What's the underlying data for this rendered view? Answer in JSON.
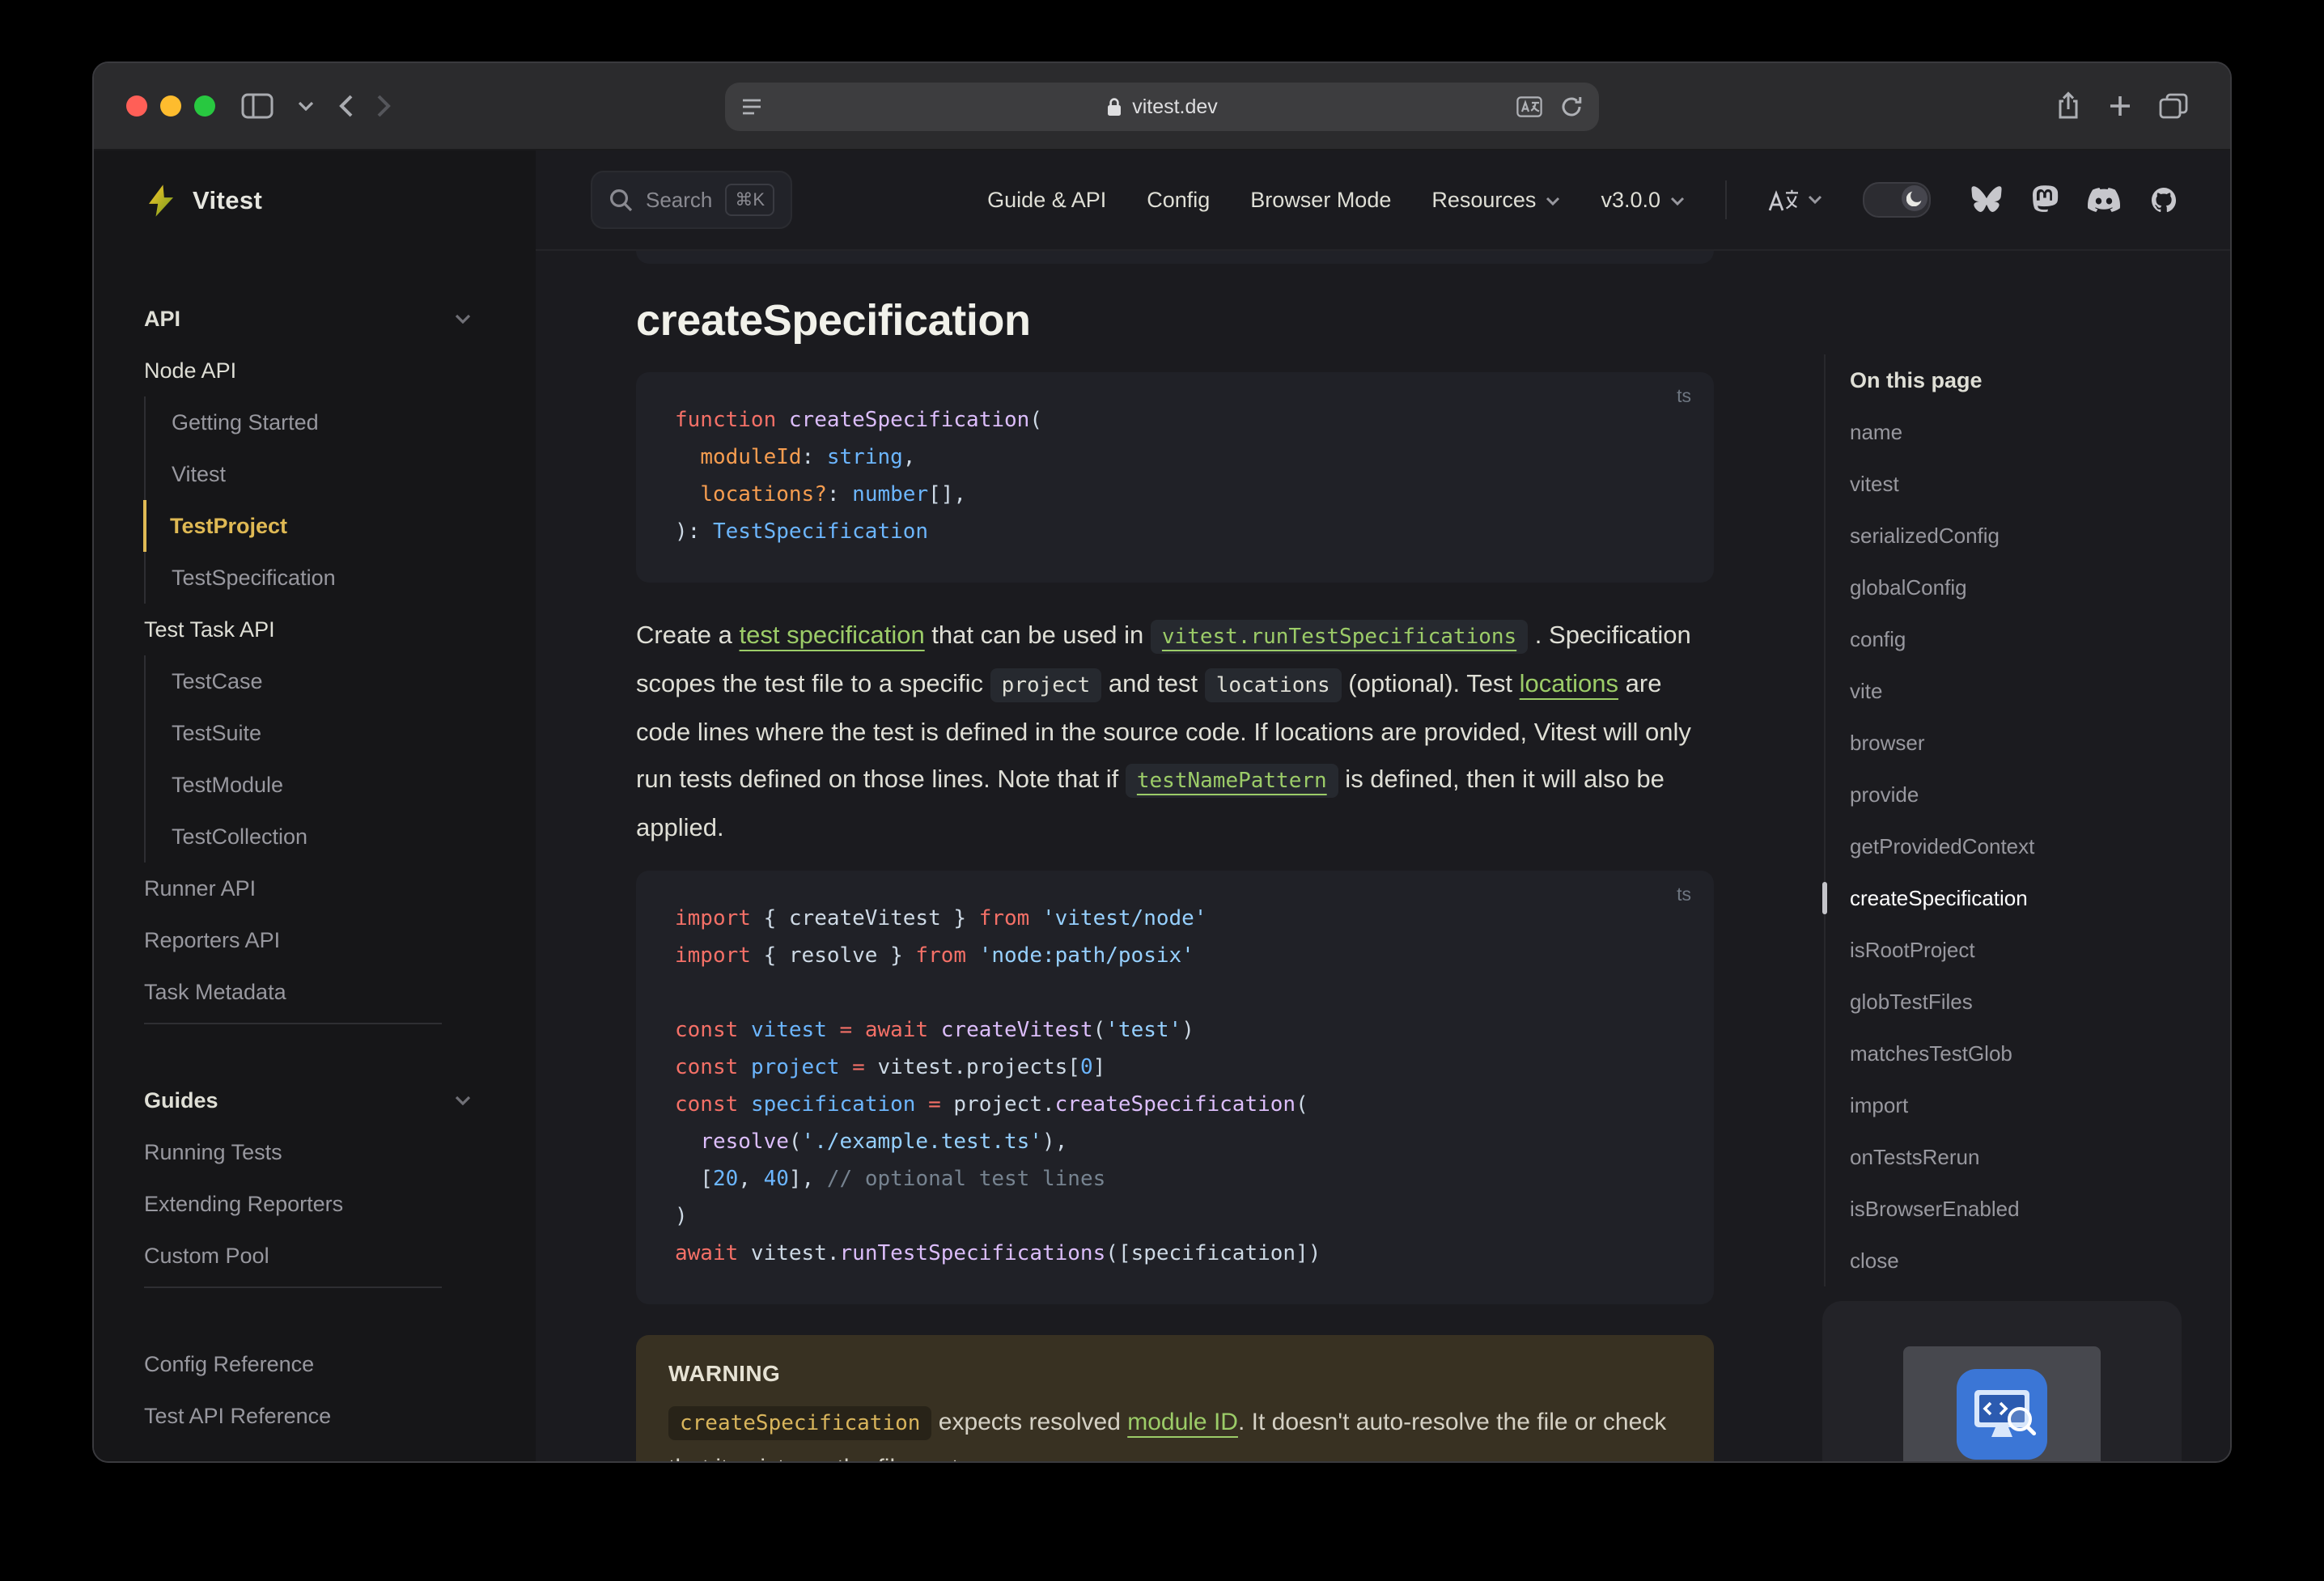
{
  "window": {
    "domain": "vitest.dev"
  },
  "colors": {
    "page_bg": "#1b1b1f",
    "sidebar_bg": "#161618",
    "code_bg": "#202127",
    "brand_yellow": "#dfb954",
    "link_green": "#9ccc68",
    "warning_bg": "#383122",
    "warning_code": "#d9b55c",
    "text_primary": "#dfdfd6",
    "text_muted": "#98989f"
  },
  "logo": {
    "label": "Vitest"
  },
  "nav": {
    "search_label": "Search",
    "search_shortcut": "⌘K",
    "links": [
      "Guide & API",
      "Config",
      "Browser Mode",
      "Resources",
      "v3.0.0"
    ]
  },
  "sidebar": {
    "sections": [
      {
        "title": "API",
        "items": [
          {
            "label": "Node API",
            "type": "heading"
          },
          {
            "label": "Getting Started",
            "type": "child"
          },
          {
            "label": "Vitest",
            "type": "child"
          },
          {
            "label": "TestProject",
            "type": "child",
            "active": true
          },
          {
            "label": "TestSpecification",
            "type": "child"
          },
          {
            "label": "Test Task API",
            "type": "heading"
          },
          {
            "label": "TestCase",
            "type": "child"
          },
          {
            "label": "TestSuite",
            "type": "child"
          },
          {
            "label": "TestModule",
            "type": "child"
          },
          {
            "label": "TestCollection",
            "type": "child"
          },
          {
            "label": "Runner API",
            "type": "link"
          },
          {
            "label": "Reporters API",
            "type": "link"
          },
          {
            "label": "Task Metadata",
            "type": "link"
          }
        ]
      },
      {
        "title": "Guides",
        "items": [
          {
            "label": "Running Tests",
            "type": "link"
          },
          {
            "label": "Extending Reporters",
            "type": "link"
          },
          {
            "label": "Custom Pool",
            "type": "link"
          }
        ]
      },
      {
        "title": "",
        "items": [
          {
            "label": "Config Reference",
            "type": "link"
          },
          {
            "label": "Test API Reference",
            "type": "link"
          }
        ]
      }
    ]
  },
  "content": {
    "title": "createSpecification",
    "code_lang": "ts",
    "code1": [
      [
        [
          "k",
          "function "
        ],
        [
          "fn",
          "createSpecification"
        ],
        [
          "p",
          "("
        ]
      ],
      [
        [
          "p",
          "  "
        ],
        [
          "o",
          "moduleId"
        ],
        [
          "p",
          ": "
        ],
        [
          "t",
          "string"
        ],
        [
          "p",
          ","
        ]
      ],
      [
        [
          "p",
          "  "
        ],
        [
          "o",
          "locations?"
        ],
        [
          "p",
          ": "
        ],
        [
          "t",
          "number"
        ],
        [
          "p",
          "[],"
        ]
      ],
      [
        [
          "p",
          "): "
        ],
        [
          "t",
          "TestSpecification"
        ]
      ]
    ],
    "paragraph": [
      {
        "k": "t",
        "t": "Create a "
      },
      {
        "k": "link",
        "t": "test specification"
      },
      {
        "k": "t",
        "t": " that can be used in "
      },
      {
        "k": "codelink",
        "t": "vitest.runTestSpecifications"
      },
      {
        "k": "t",
        "t": " . Specification scopes the test file to a specific "
      },
      {
        "k": "code",
        "t": "project"
      },
      {
        "k": "t",
        "t": " and test "
      },
      {
        "k": "code",
        "t": "locations"
      },
      {
        "k": "t",
        "t": " (optional). Test "
      },
      {
        "k": "link",
        "t": "locations"
      },
      {
        "k": "t",
        "t": " are code lines where the test is defined in the source code. If locations are provided, Vitest will only run tests defined on those lines. Note that if "
      },
      {
        "k": "codelink",
        "t": "testNamePattern"
      },
      {
        "k": "t",
        "t": " is defined, then it will also be applied."
      }
    ],
    "code2": [
      [
        [
          "k",
          "import"
        ],
        [
          "p",
          " { createVitest } "
        ],
        [
          "k",
          "from"
        ],
        [
          "p",
          " "
        ],
        [
          "s",
          "'vitest/node'"
        ]
      ],
      [
        [
          "k",
          "import"
        ],
        [
          "p",
          " { resolve } "
        ],
        [
          "k",
          "from"
        ],
        [
          "p",
          " "
        ],
        [
          "s",
          "'node:path/posix'"
        ]
      ],
      [],
      [
        [
          "k",
          "const"
        ],
        [
          "p",
          " "
        ],
        [
          "t",
          "vitest"
        ],
        [
          "p",
          " "
        ],
        [
          "k",
          "="
        ],
        [
          "p",
          " "
        ],
        [
          "k",
          "await"
        ],
        [
          "p",
          " "
        ],
        [
          "fn",
          "createVitest"
        ],
        [
          "p",
          "("
        ],
        [
          "s",
          "'test'"
        ],
        [
          "p",
          ")"
        ]
      ],
      [
        [
          "k",
          "const"
        ],
        [
          "p",
          " "
        ],
        [
          "t",
          "project"
        ],
        [
          "p",
          " "
        ],
        [
          "k",
          "="
        ],
        [
          "p",
          " vitest.projects["
        ],
        [
          "n",
          "0"
        ],
        [
          "p",
          "]"
        ]
      ],
      [
        [
          "k",
          "const"
        ],
        [
          "p",
          " "
        ],
        [
          "t",
          "specification"
        ],
        [
          "p",
          " "
        ],
        [
          "k",
          "="
        ],
        [
          "p",
          " project."
        ],
        [
          "fn",
          "createSpecification"
        ],
        [
          "p",
          "("
        ]
      ],
      [
        [
          "p",
          "  "
        ],
        [
          "fn",
          "resolve"
        ],
        [
          "p",
          "("
        ],
        [
          "s",
          "'./example.test.ts'"
        ],
        [
          "p",
          "),"
        ]
      ],
      [
        [
          "p",
          "  ["
        ],
        [
          "n",
          "20"
        ],
        [
          "p",
          ", "
        ],
        [
          "n",
          "40"
        ],
        [
          "p",
          "], "
        ],
        [
          "c",
          "// optional test lines"
        ]
      ],
      [
        [
          "p",
          ")"
        ]
      ],
      [
        [
          "k",
          "await"
        ],
        [
          "p",
          " vitest."
        ],
        [
          "fn",
          "runTestSpecifications"
        ],
        [
          "p",
          "(["
        ],
        [
          "p",
          "specification"
        ],
        [
          "p",
          "])"
        ]
      ]
    ],
    "warning": {
      "title": "WARNING",
      "segments": [
        {
          "k": "wcode",
          "t": "createSpecification"
        },
        {
          "k": "t",
          "t": " expects resolved "
        },
        {
          "k": "link",
          "t": "module ID"
        },
        {
          "k": "t",
          "t": ". It doesn't auto-resolve the file or check that it exists on the file system."
        }
      ]
    }
  },
  "outline": {
    "title": "On this page",
    "items": [
      {
        "label": "name"
      },
      {
        "label": "vitest"
      },
      {
        "label": "serializedConfig"
      },
      {
        "label": "globalConfig"
      },
      {
        "label": "config"
      },
      {
        "label": "vite"
      },
      {
        "label": "browser"
      },
      {
        "label": "provide"
      },
      {
        "label": "getProvidedContext"
      },
      {
        "label": "createSpecification",
        "active": true
      },
      {
        "label": "isRootProject"
      },
      {
        "label": "globTestFiles"
      },
      {
        "label": "matchesTestGlob"
      },
      {
        "label": "import"
      },
      {
        "label": "onTestsRerun"
      },
      {
        "label": "isBrowserEnabled"
      },
      {
        "label": "close"
      }
    ]
  }
}
